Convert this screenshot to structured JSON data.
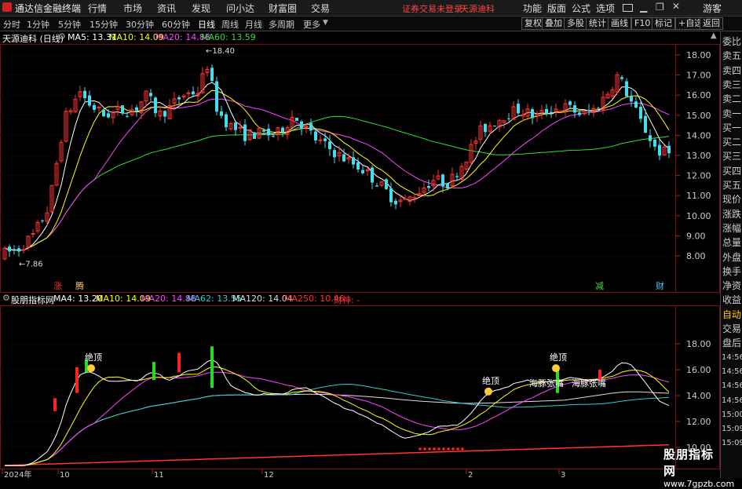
{
  "menu": {
    "app_title": "通达信金融终端",
    "items": [
      "行情",
      "市场",
      "资讯",
      "发现",
      "问小达",
      "财富圈",
      "交易"
    ],
    "status_text": "证券交易未登录",
    "stock_name_red": "天源迪科",
    "right_items": [
      "功能",
      "版面",
      "公式",
      "选项"
    ],
    "guest": "游客"
  },
  "toolbar": {
    "tabs": [
      "分时",
      "1分钟",
      "5分钟",
      "15分钟",
      "30分钟",
      "60分钟",
      "日线",
      "周线",
      "月线",
      "多周期",
      "更多"
    ],
    "active_tab": "日线",
    "right_buttons": [
      "复权",
      "叠加",
      "多股",
      "统计",
      "画线",
      "F10",
      "标记",
      "+自选",
      "返回"
    ]
  },
  "main_chart": {
    "title": "天源迪科 (日线)",
    "ma_labels": [
      {
        "text": "MA5: 13.31",
        "color": "#ffffff"
      },
      {
        "text": "MA10: 14.09",
        "color": "#ffff00"
      },
      {
        "text": "MA20: 14.88",
        "color": "#ff44ff"
      },
      {
        "text": "MA60: 13.59",
        "color": "#33dd33"
      }
    ],
    "y_ticks": [
      "18.00",
      "17.00",
      "16.00",
      "15.00",
      "14.00",
      "13.00",
      "12.00",
      "11.00",
      "10.00",
      "9.00",
      "8.00"
    ],
    "high_label": "18.40",
    "low_label": "7.86",
    "markers": [
      {
        "text": "涨",
        "color": "#ff3333"
      },
      {
        "text": "腾",
        "color": "#ffcc66"
      },
      {
        "text": "减",
        "color": "#44dd44"
      },
      {
        "text": "财",
        "color": "#44ccff"
      }
    ]
  },
  "indicator": {
    "title": "股朋指标网",
    "labels": [
      {
        "text": "MA4: 13.20",
        "color": "#ffffff"
      },
      {
        "text": "MA10: 14.09",
        "color": "#ffff00"
      },
      {
        "text": "MA20: 14.88",
        "color": "#ff44ff"
      },
      {
        "text": "MA62: 13.55",
        "color": "#33cccc"
      },
      {
        "text": "MA120: 14.04",
        "color": "#dddddd"
      },
      {
        "text": "MA250: 10.46",
        "color": "#ff3333"
      },
      {
        "text": "财神: -",
        "color": "#ff3333"
      }
    ],
    "y_ticks": [
      "18.00",
      "16.00",
      "14.00",
      "12.00",
      "10.00"
    ],
    "annotations": [
      "绝顶",
      "绝顶",
      "绝顶",
      "海豚张嘴",
      "海豚张嘴"
    ]
  },
  "x_axis": [
    "2024年",
    "10",
    "11",
    "12",
    "2",
    "3"
  ],
  "right_panel": [
    "委比",
    "卖五",
    "卖四",
    "卖三",
    "卖二",
    "卖一",
    "买一",
    "买二",
    "买三",
    "买四",
    "买五",
    "现价",
    "涨跌",
    "涨幅",
    "总量",
    "外盘",
    "换手",
    "净资",
    "收益",
    "自动",
    "交易",
    "盘后",
    "14:56",
    "14:56",
    "14:56",
    "14:56",
    "15:00",
    "15:09",
    "15:09"
  ],
  "watermark": {
    "line1": "股朋指标网",
    "line2": "www.7gpzb.com"
  },
  "colors": {
    "up": "#ff3333",
    "down": "#44ddee",
    "ma5": "#ffffff",
    "ma10": "#ffff00",
    "ma20": "#ff44ff",
    "ma60": "#33dd33",
    "ma62": "#33cccc",
    "ma250": "#ff3333"
  }
}
